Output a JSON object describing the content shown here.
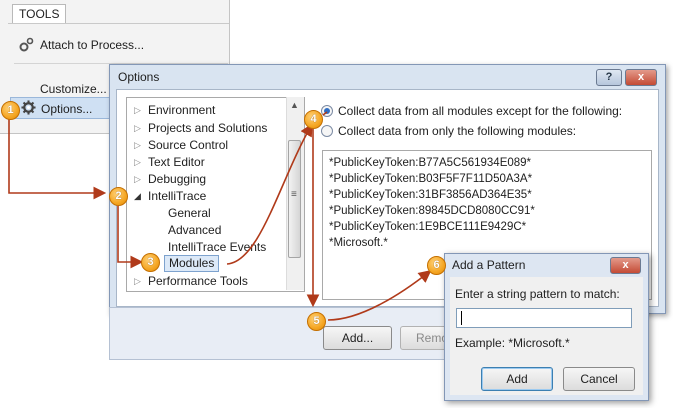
{
  "tools_menu": {
    "title": "TOOLS",
    "items": [
      "Attach to Process...",
      "Customize...",
      "Options..."
    ]
  },
  "options_dialog": {
    "title": "Options",
    "help_label": "?",
    "close_label": "x",
    "tree": [
      {
        "label": "Environment"
      },
      {
        "label": "Projects and Solutions"
      },
      {
        "label": "Source Control"
      },
      {
        "label": "Text Editor"
      },
      {
        "label": "Debugging"
      },
      {
        "label": "IntelliTrace"
      },
      {
        "label": "General"
      },
      {
        "label": "Advanced"
      },
      {
        "label": "IntelliTrace Events"
      },
      {
        "label": "Modules"
      },
      {
        "label": "Performance Tools"
      }
    ],
    "radio_all": "Collect data from all modules except for the following:",
    "radio_only": "Collect data from only the following modules:",
    "modules": [
      "*PublicKeyToken:B77A5C561934E089*",
      "*PublicKeyToken:B03F5F7F11D50A3A*",
      "*PublicKeyToken:31BF3856AD364E35*",
      "*PublicKeyToken:89845DCD8080CC91*",
      "*PublicKeyToken:1E9BCE111E9429C*",
      "*Microsoft.*"
    ],
    "add_button": "Add...",
    "remove_button": "Remo"
  },
  "pattern_dialog": {
    "title": "Add a Pattern",
    "close_label": "x",
    "prompt": "Enter a string pattern to match:",
    "input_value": "",
    "example": "Example: *Microsoft.*",
    "add_button": "Add",
    "cancel_button": "Cancel"
  },
  "callouts": [
    "1",
    "2",
    "3",
    "4",
    "5",
    "6"
  ],
  "colors": {
    "callout": "#f5a623",
    "arrow": "#b03a1a",
    "selection": "#dce9f8"
  }
}
